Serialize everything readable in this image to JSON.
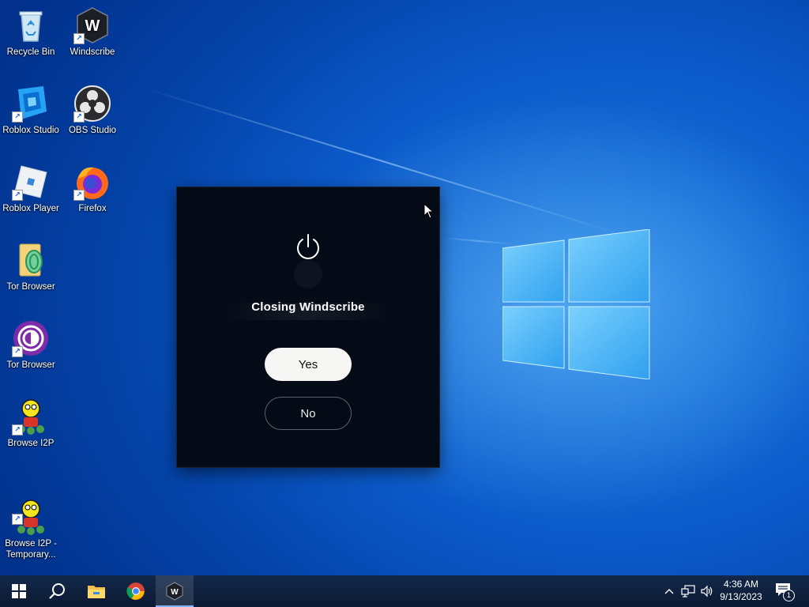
{
  "desktop": {
    "icons": [
      {
        "label": "Recycle Bin",
        "icon": "recycle-bin-icon"
      },
      {
        "label": "Windscribe",
        "icon": "windscribe-icon"
      },
      {
        "label": "Roblox Studio",
        "icon": "roblox-studio-icon"
      },
      {
        "label": "OBS Studio",
        "icon": "obs-studio-icon"
      },
      {
        "label": "Roblox Player",
        "icon": "roblox-player-icon"
      },
      {
        "label": "Firefox",
        "icon": "firefox-icon"
      },
      {
        "label": "Tor Browser",
        "icon": "tor-browser-folder-icon"
      },
      {
        "label": "Tor Browser",
        "icon": "tor-browser-icon"
      },
      {
        "label": "Browse I2P",
        "icon": "i2p-icon"
      },
      {
        "label": "Browse I2P -\nTemporary...",
        "icon": "i2p-icon"
      }
    ]
  },
  "dialog": {
    "title": "Closing Windscribe",
    "yes_label": "Yes",
    "no_label": "No",
    "icon": "power-icon"
  },
  "taskbar": {
    "start": "windows-start-icon",
    "search": "search-icon",
    "pinned": [
      "file-explorer-icon",
      "chrome-icon",
      "windscribe-icon"
    ],
    "time": "4:36 AM",
    "date": "9/13/2023",
    "notification_count": "1"
  },
  "colors": {
    "dialog_bg": "#050b16",
    "yes_button_bg": "#f6f6f4",
    "taskbar_bg": "#0e1f3a",
    "desktop_accent": "#0b59c9"
  }
}
